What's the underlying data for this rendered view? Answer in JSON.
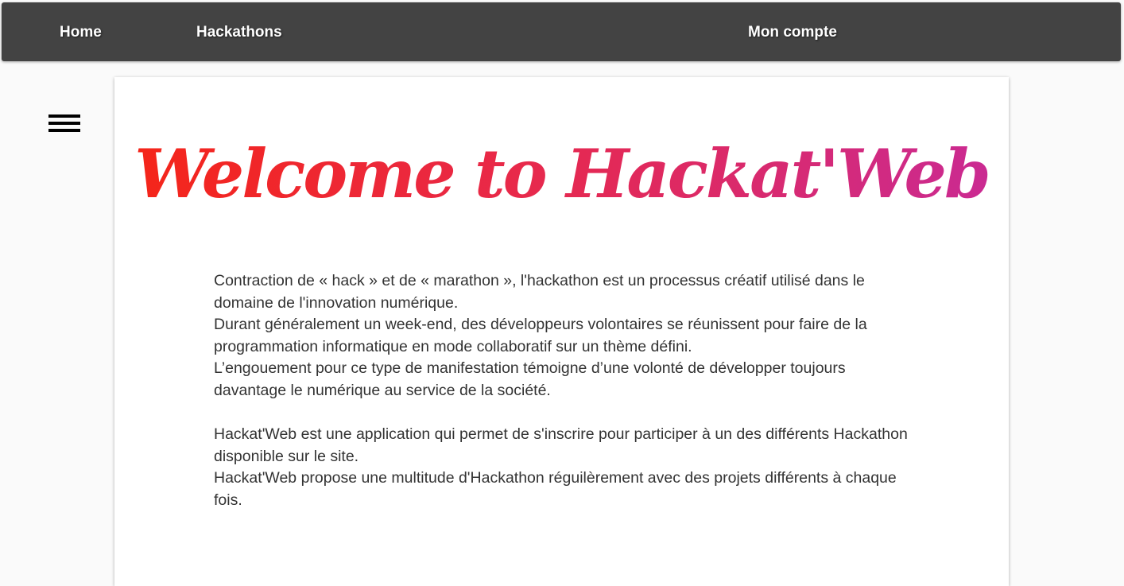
{
  "nav": {
    "home": "Home",
    "hackathons": "Hackathons",
    "account": "Mon compte"
  },
  "sidebar": {
    "toggle_icon": "hamburger-menu-icon"
  },
  "main": {
    "title": "Welcome to Hackat'Web",
    "title_gradient": [
      "#f52517",
      "#e8294a",
      "#c92a95"
    ],
    "paragraphs": [
      "Contraction de « hack » et de « marathon », l'hackathon est un processus créatif utilisé dans le domaine de l'innovation numérique.",
      "Durant généralement un week-end, des développeurs volontaires se réunissent pour faire de la programmation informatique en mode collaboratif sur un thème défini.",
      "L’engouement pour ce type de manifestation témoigne d’une volonté de développer toujours davantage le numérique au service de la société.",
      "Hackat'Web est une application qui permet de s'inscrire pour participer à un des différents Hackathon disponible sur le site.",
      "Hackat'Web propose une multitude d'Hackathon réguilèrement avec des projets différents à chaque fois."
    ]
  },
  "colors": {
    "navbar_bg": "#434343",
    "page_bg": "#fafafa",
    "text": "#333333"
  }
}
